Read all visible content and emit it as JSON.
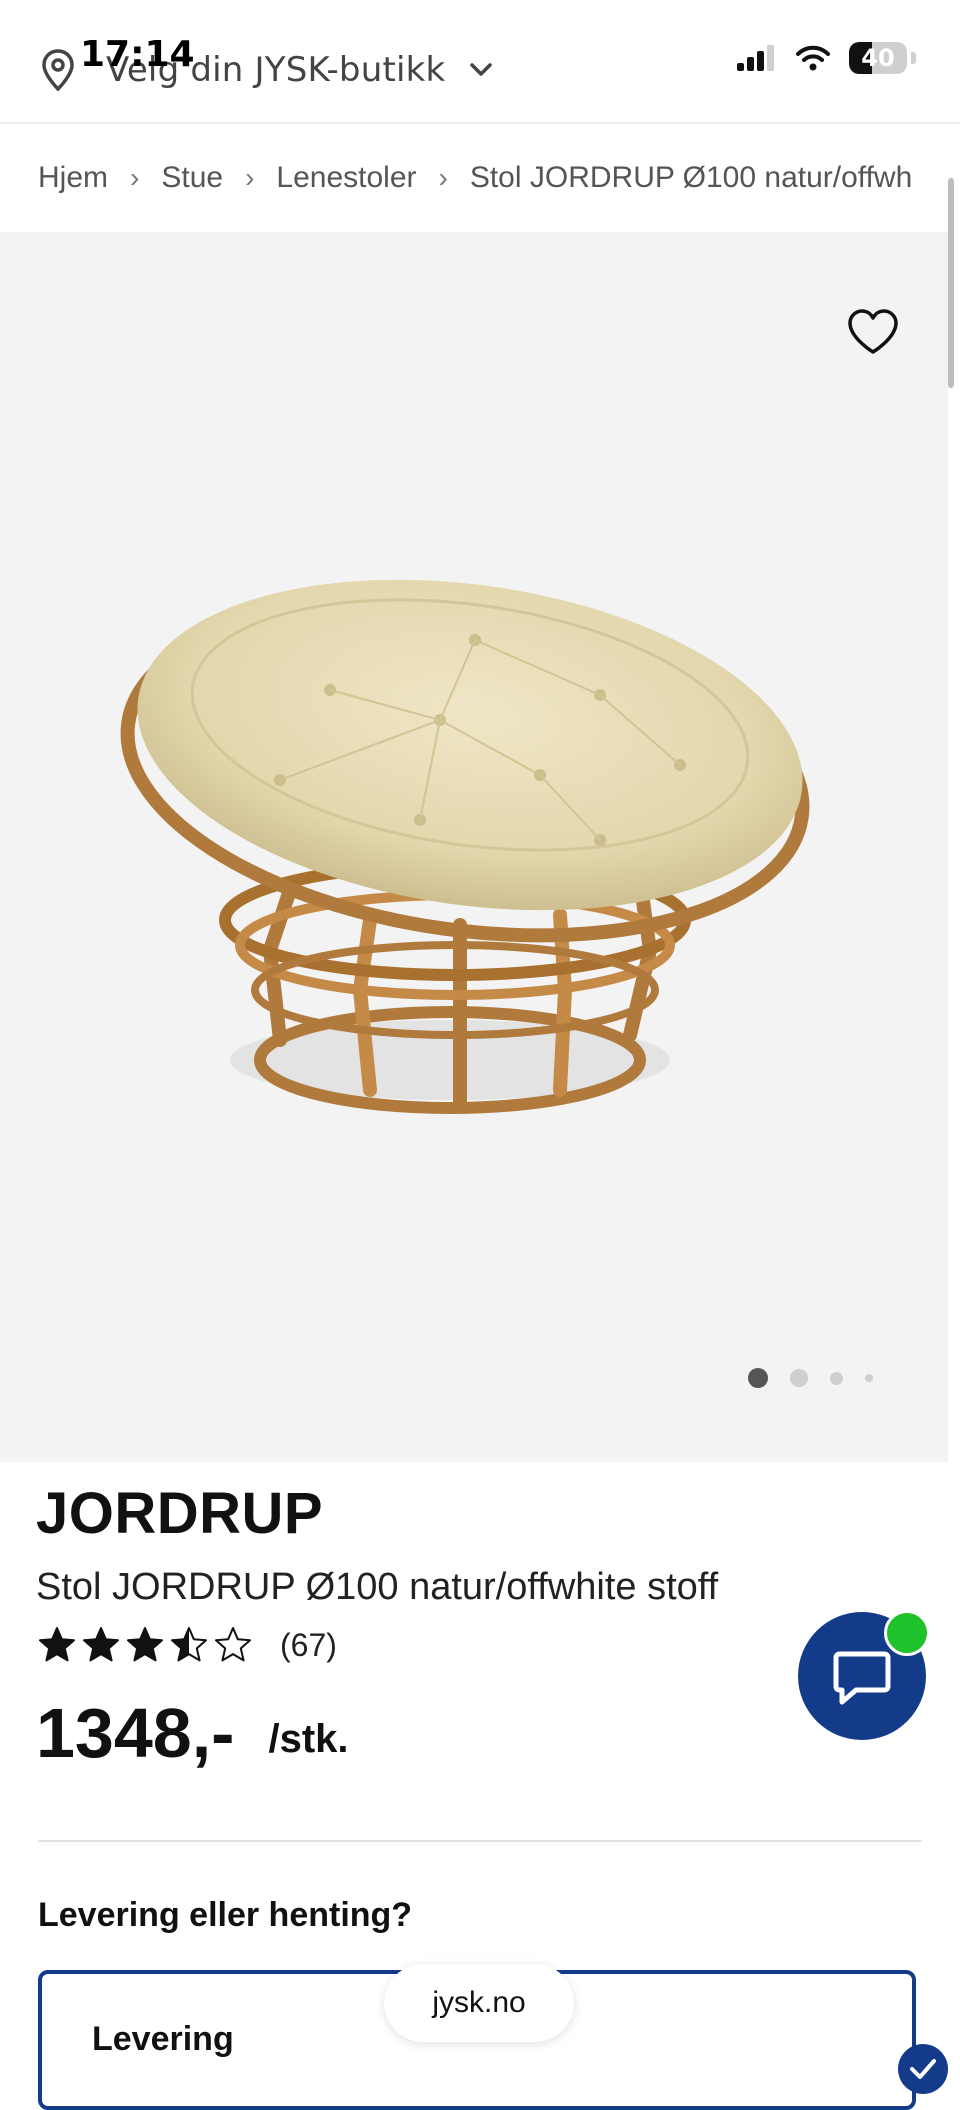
{
  "status_bar": {
    "time": "17:14",
    "battery": "40",
    "battery_level": 0.4
  },
  "header": {
    "store_picker_label": "Velg din JYSK-butikk"
  },
  "breadcrumb": {
    "items": [
      "Hjem",
      "Stue",
      "Lenestoler",
      "Stol JORDRUP Ø100 natur/offwh"
    ]
  },
  "gallery": {
    "image_count": 4,
    "active_index": 0,
    "favorite_icon": "heart-outline-icon"
  },
  "product": {
    "brand": "JORDRUP",
    "name": "Stol JORDRUP Ø100 natur/offwhite stoff",
    "rating": {
      "value": 3.5,
      "max": 5,
      "count_label": "(67)"
    },
    "price": "1348,-",
    "unit": "/stk."
  },
  "fulfillment": {
    "question": "Levering eller henting?",
    "selected_option_label": "Levering"
  },
  "browser": {
    "url": "jysk.no"
  },
  "colors": {
    "brand_blue": "#143b8a",
    "online_green": "#1fc22a",
    "gallery_bg": "#f3f3f3"
  }
}
